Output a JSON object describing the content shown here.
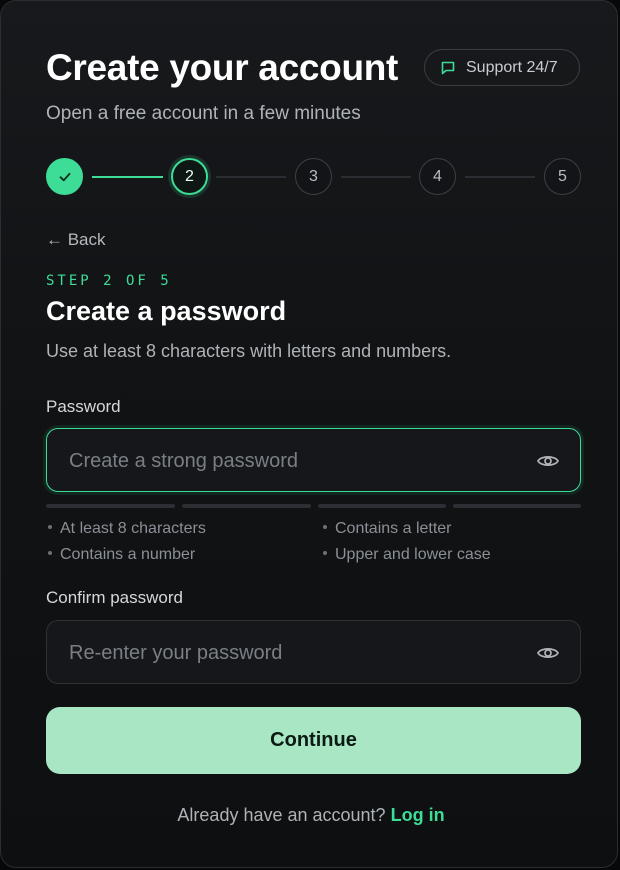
{
  "header": {
    "title": "Create your account",
    "subtitle": "Open a free account in a few minutes",
    "support_label": "Support 24/7",
    "support_icon": "chat-bubble-icon"
  },
  "stepper": {
    "current_step": 2,
    "total_steps": 5,
    "steps": [
      {
        "label": "",
        "state": "done",
        "icon": "check-icon"
      },
      {
        "label": "2",
        "state": "active"
      },
      {
        "label": "3",
        "state": "upcoming"
      },
      {
        "label": "4",
        "state": "upcoming"
      },
      {
        "label": "5",
        "state": "upcoming"
      }
    ]
  },
  "back_label": "← Back",
  "step_eyebrow": "STEP 2 OF 5",
  "form": {
    "heading": "Create a password",
    "description": "Use at least 8 characters with letters and numbers.",
    "password": {
      "label": "Password",
      "placeholder": "Create a strong password",
      "value": "",
      "icon": "eye-icon"
    },
    "strength_filled": 0,
    "strength_segments": 4,
    "requirements": [
      "At least 8 characters",
      "Contains a letter",
      "Contains a number",
      "Upper and lower case"
    ],
    "confirm": {
      "label": "Confirm password",
      "placeholder": "Re-enter your password",
      "value": "",
      "icon": "eye-icon"
    },
    "continue_label": "Continue"
  },
  "footer": {
    "prompt": "Already have an account?",
    "link_label": "Log in"
  },
  "colors": {
    "accent": "#3ddc97",
    "button_bg": "#a8e6c4",
    "background": "#111315"
  }
}
